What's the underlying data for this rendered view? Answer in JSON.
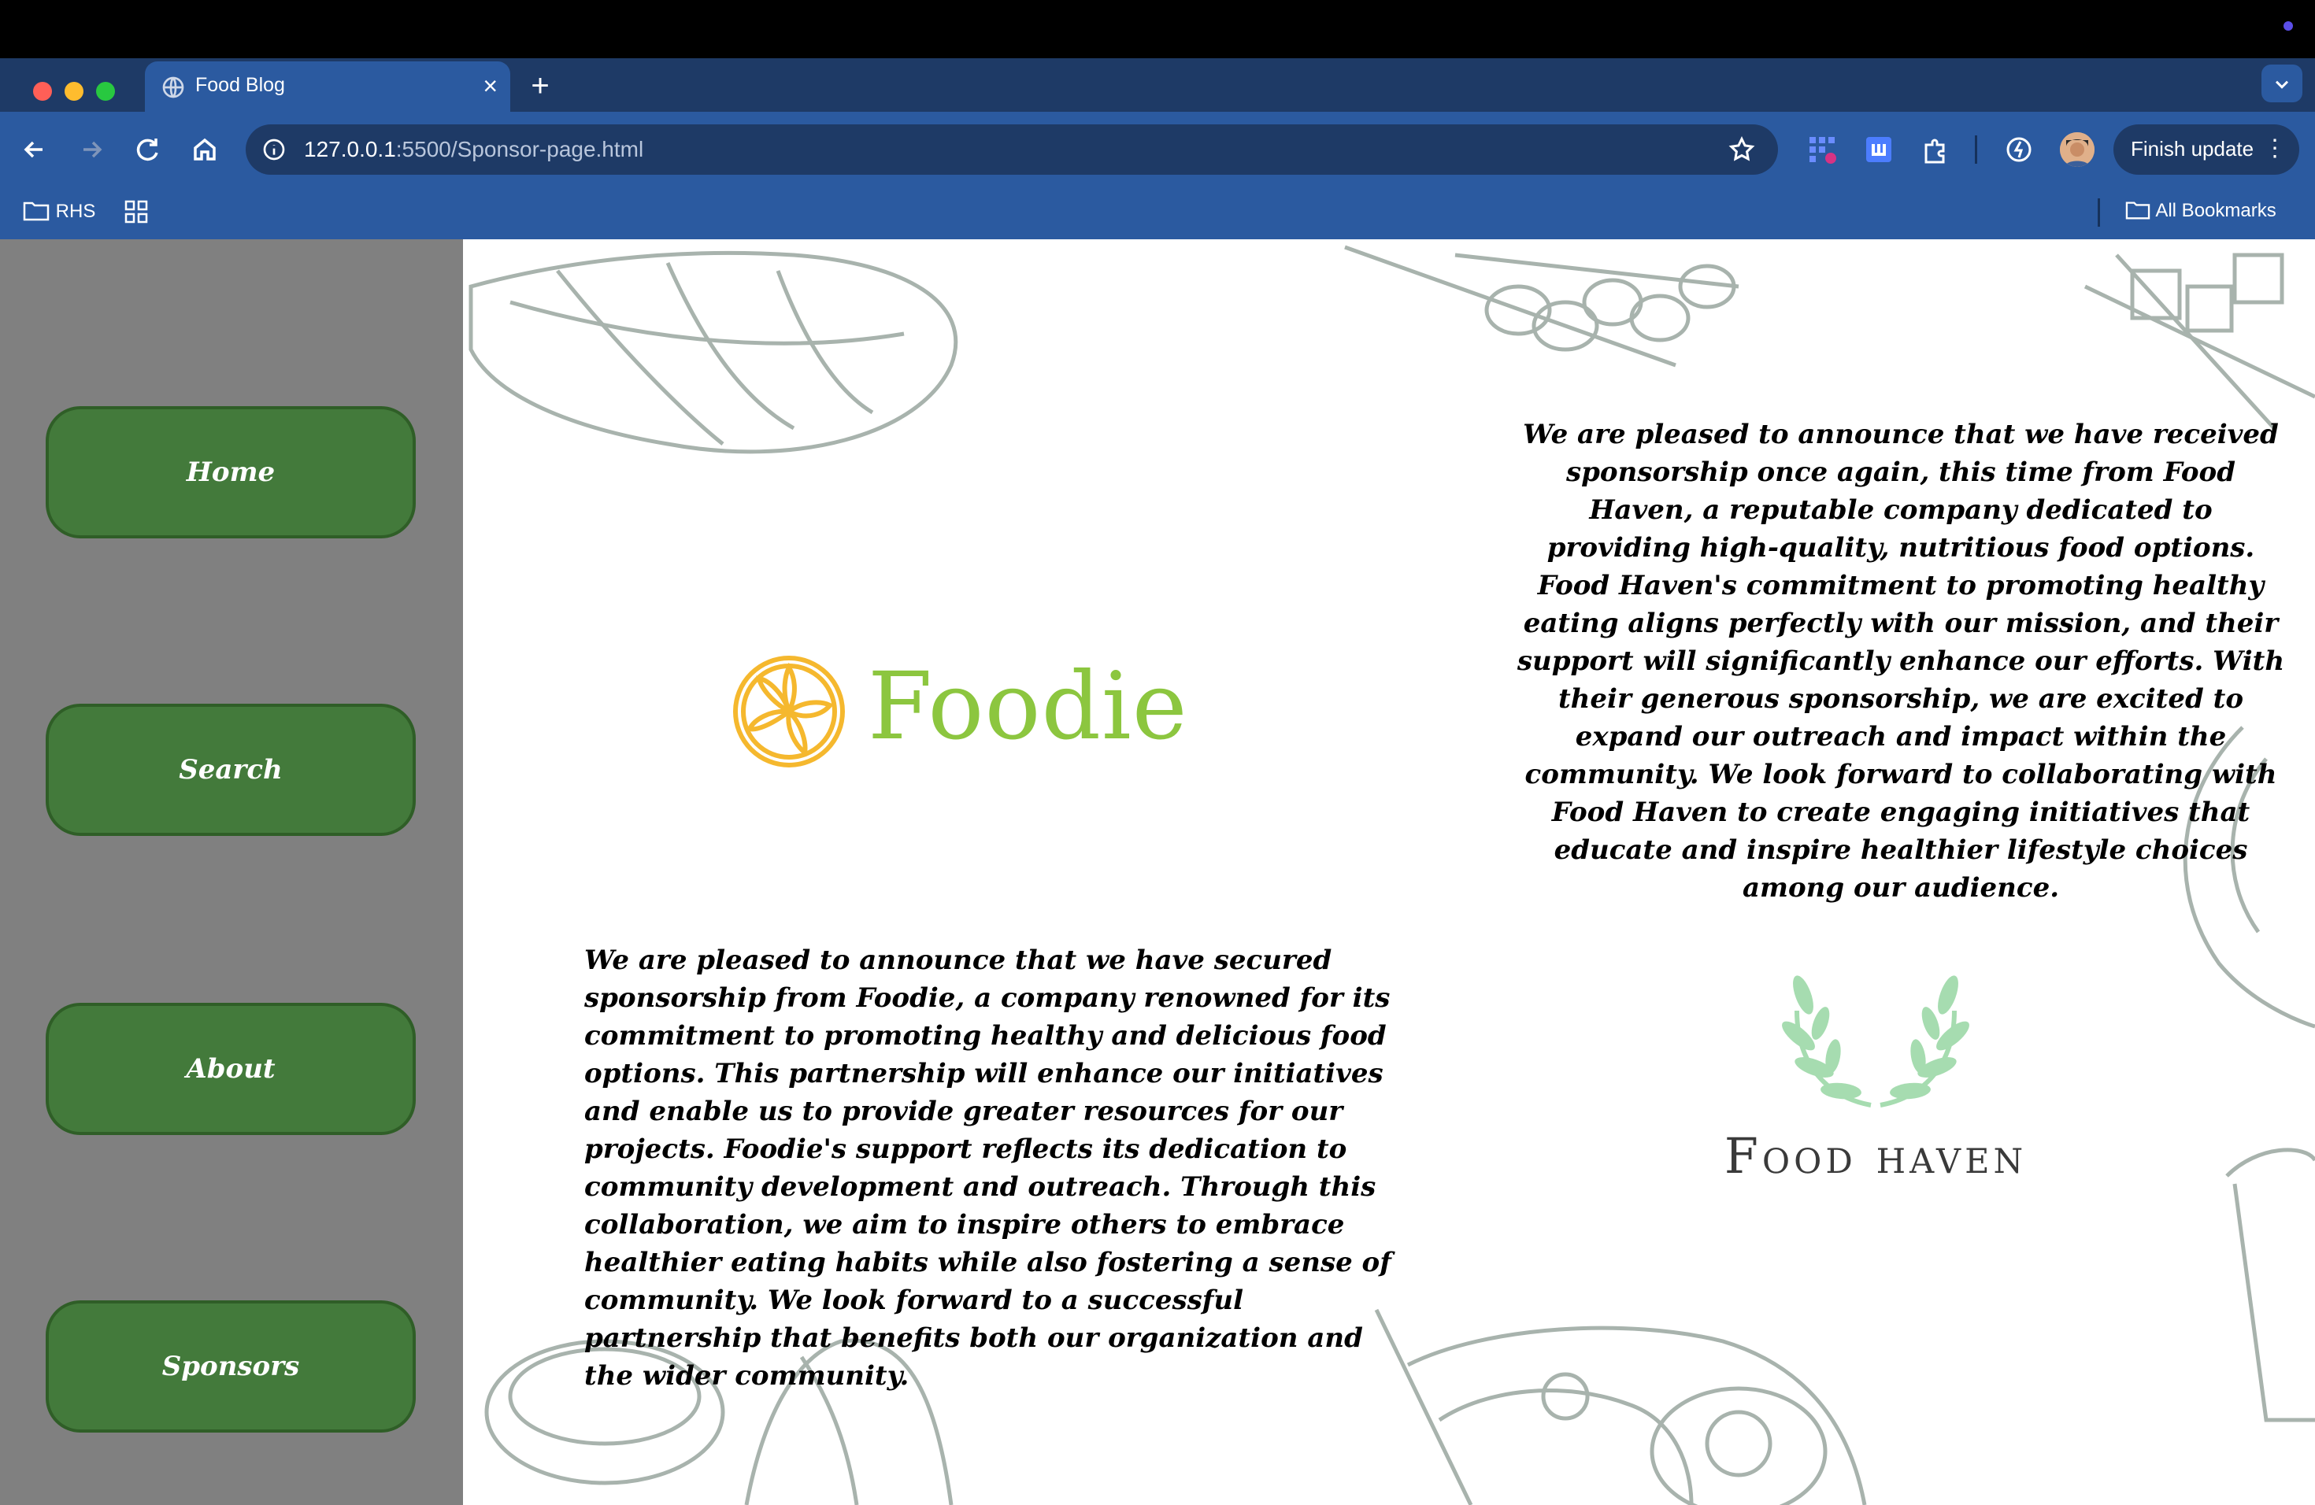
{
  "browser": {
    "tab_title": "Food Blog",
    "url_host": "127.0.0.1",
    "url_rest": ":5500/Sponsor-page.html",
    "finish_update_label": "Finish update",
    "bookmarks": {
      "rhs_label": "RHS",
      "all_bookmarks_label": "All Bookmarks"
    }
  },
  "sidebar": {
    "items": [
      {
        "label": "Home"
      },
      {
        "label": "Search"
      },
      {
        "label": "About"
      },
      {
        "label": "Sponsors"
      }
    ]
  },
  "sponsors": {
    "food_haven_text": "We are pleased to announce that we have received sponsorship once again, this time from Food Haven, a reputable company dedicated to providing high-quality, nutritious food options. Food Haven's commitment to promoting healthy eating aligns perfectly with our mission, and their support will significantly enhance our efforts. With their generous sponsorship, we are excited to expand our outreach and impact within the community. We look forward to collaborating with Food Haven to create engaging initiatives that educate and inspire healthier lifestyle choices among our audience.",
    "foodie_text": "We are pleased to announce that we have secured sponsorship from Foodie, a company renowned for its commitment to promoting healthy and delicious food options. This partnership will enhance our initiatives and enable us to provide greater resources for our projects. Foodie's support reflects its dedication to community development and outreach. Through this collaboration, we aim to inspire others to embrace healthier eating habits while also fostering a sense of community. We look forward to a successful partnership that benefits both our organization and the wider community.",
    "foodie_logo_text": "Foodie",
    "food_haven_logo_text": "Food haven"
  },
  "colors": {
    "tab_strip": "#1e3a66",
    "toolbar": "#2b5aa0",
    "sidebar": "#808080",
    "nav_button": "#437a3b",
    "foodie_green": "#8cc63f",
    "foodie_orange": "#f5b82e"
  }
}
